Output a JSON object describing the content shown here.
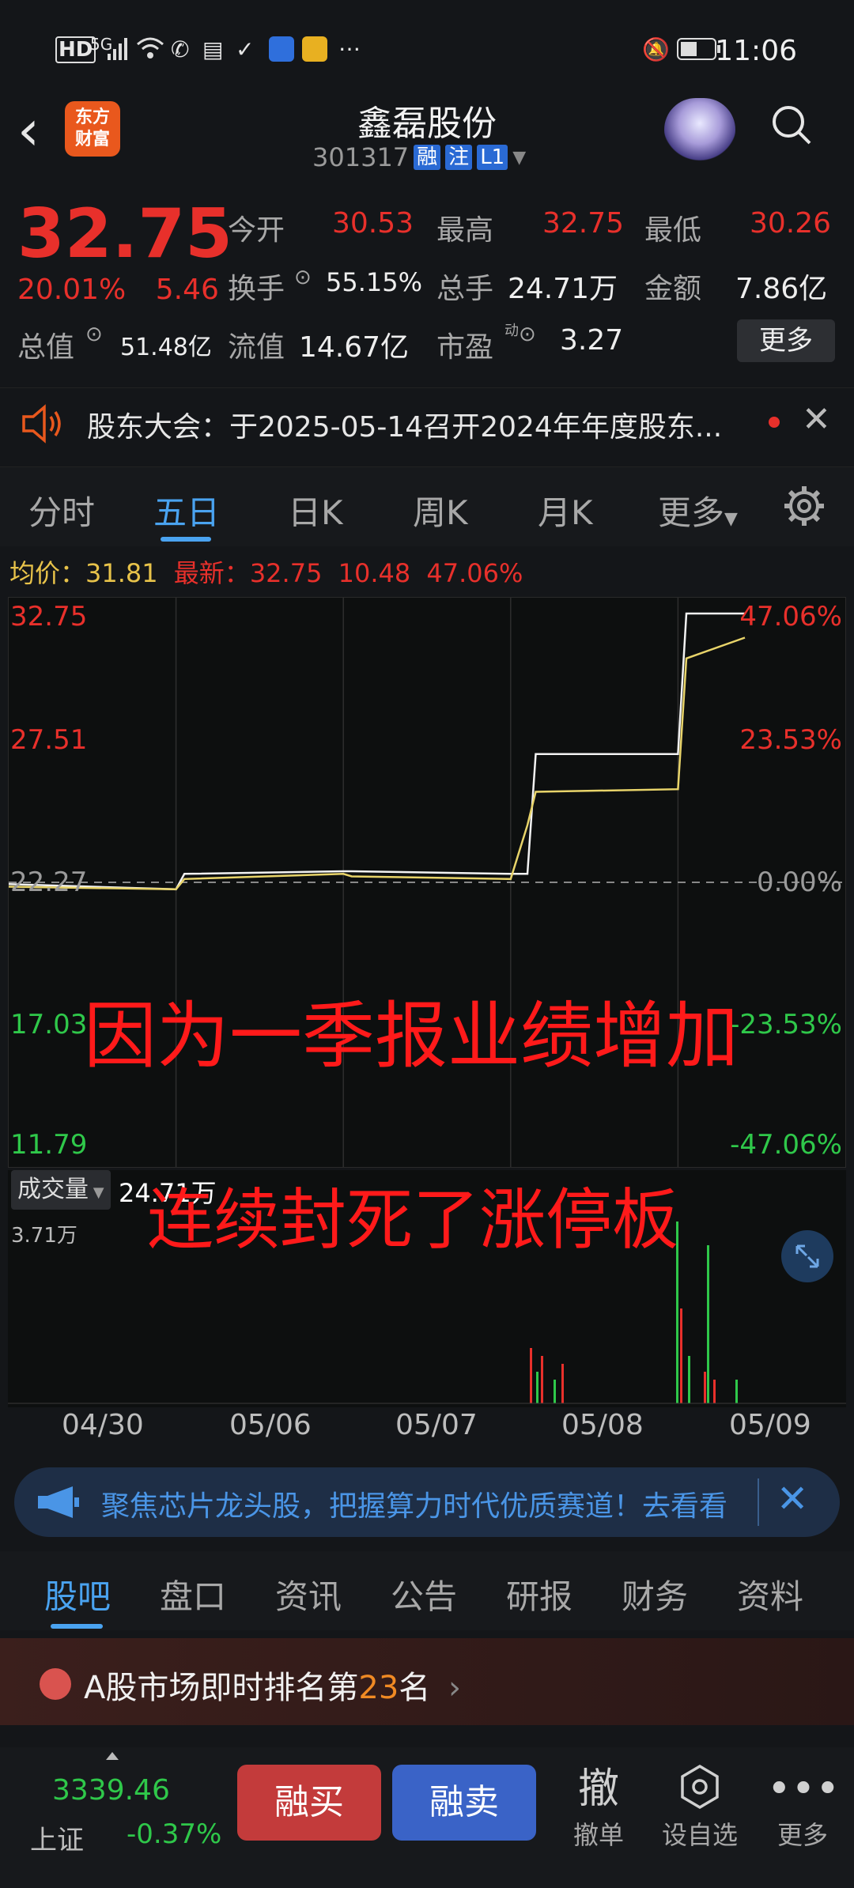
{
  "status_bar": {
    "left_icons": [
      "HD",
      "5G",
      "signal",
      "wifi",
      "phone",
      "sim",
      "check",
      "app1",
      "app2",
      "…"
    ],
    "time": "11:06"
  },
  "header": {
    "logo_line1": "东方",
    "logo_line2": "财富",
    "title": "鑫磊股份",
    "code": "301317",
    "tags": [
      "融",
      "注",
      "L1"
    ]
  },
  "quote": {
    "price": "32.75",
    "change_pct": "20.01%",
    "change_abs": "5.46",
    "rows": [
      [
        {
          "label": "今开",
          "value": "30.53"
        },
        {
          "label": "最高",
          "value": "32.75"
        },
        {
          "label": "最低",
          "value": "30.26"
        }
      ],
      [
        {
          "label": "换手",
          "value": "55.15%"
        },
        {
          "label": "总手",
          "value": "24.71万"
        },
        {
          "label": "金额",
          "value": "7.86亿"
        }
      ],
      [
        {
          "label": "总值",
          "value": "51.48亿"
        },
        {
          "label": "流值",
          "value": "14.67亿"
        },
        {
          "label": "市盈",
          "value": "3.27"
        }
      ]
    ],
    "pe_superscript": "动",
    "more_label": "更多"
  },
  "notice": {
    "text": "股东大会：于2025-05-14召开2024年年度股东..."
  },
  "chart_tabs": [
    "分时",
    "五日",
    "日K",
    "周K",
    "月K",
    "更多"
  ],
  "chart_info": {
    "avg_label": "均价：",
    "avg_value": "31.81",
    "latest_label": "最新：",
    "latest_value": "32.75",
    "latest_change": "10.48",
    "latest_pct": "47.06%"
  },
  "chart_data": {
    "type": "line",
    "title": "",
    "x": [
      "04/30",
      "05/06",
      "05/07",
      "05/08",
      "05/09"
    ],
    "y_left_ticks": [
      "32.75",
      "27.51",
      "22.27",
      "17.03",
      "11.79"
    ],
    "y_right_ticks": [
      "47.06%",
      "23.53%",
      "0.00%",
      "-23.53%",
      "-47.06%"
    ],
    "ylim": [
      11.79,
      32.75
    ],
    "baseline": 22.27,
    "series": [
      {
        "values": [
          22.2,
          22.0,
          22.6,
          22.7,
          22.7,
          22.6,
          22.6,
          27.27,
          27.27,
          32.75,
          32.75
        ]
      },
      {
        "values": [
          22.1,
          22.0,
          22.4,
          22.6,
          22.5,
          22.4,
          24.5,
          25.8,
          25.9,
          31.0,
          31.81
        ]
      }
    ],
    "volume": {
      "label": "成交量",
      "total": "24.71万",
      "max_label": "3.71万"
    }
  },
  "overlay_text": {
    "line1": "因为一季报业绩增加",
    "line2": "连续封死了涨停板"
  },
  "banner": {
    "text": "聚焦芯片龙头股，把握算力时代优质赛道！去看看"
  },
  "info_tabs": [
    "股吧",
    "盘口",
    "资讯",
    "公告",
    "研报",
    "财务",
    "资料"
  ],
  "rank": {
    "prefix": "A股市场即时排名第",
    "number": "23",
    "suffix": "名"
  },
  "bottom_bar": {
    "index_value": "3339.46",
    "index_name": "上证",
    "index_change": "-0.37%",
    "buy_label": "融买",
    "sell_label": "融卖",
    "items": [
      {
        "icon": "撤",
        "label": "撤单"
      },
      {
        "icon": "set-icon",
        "label": "设自选"
      },
      {
        "icon": "more-dots-icon",
        "label": "更多"
      }
    ]
  }
}
